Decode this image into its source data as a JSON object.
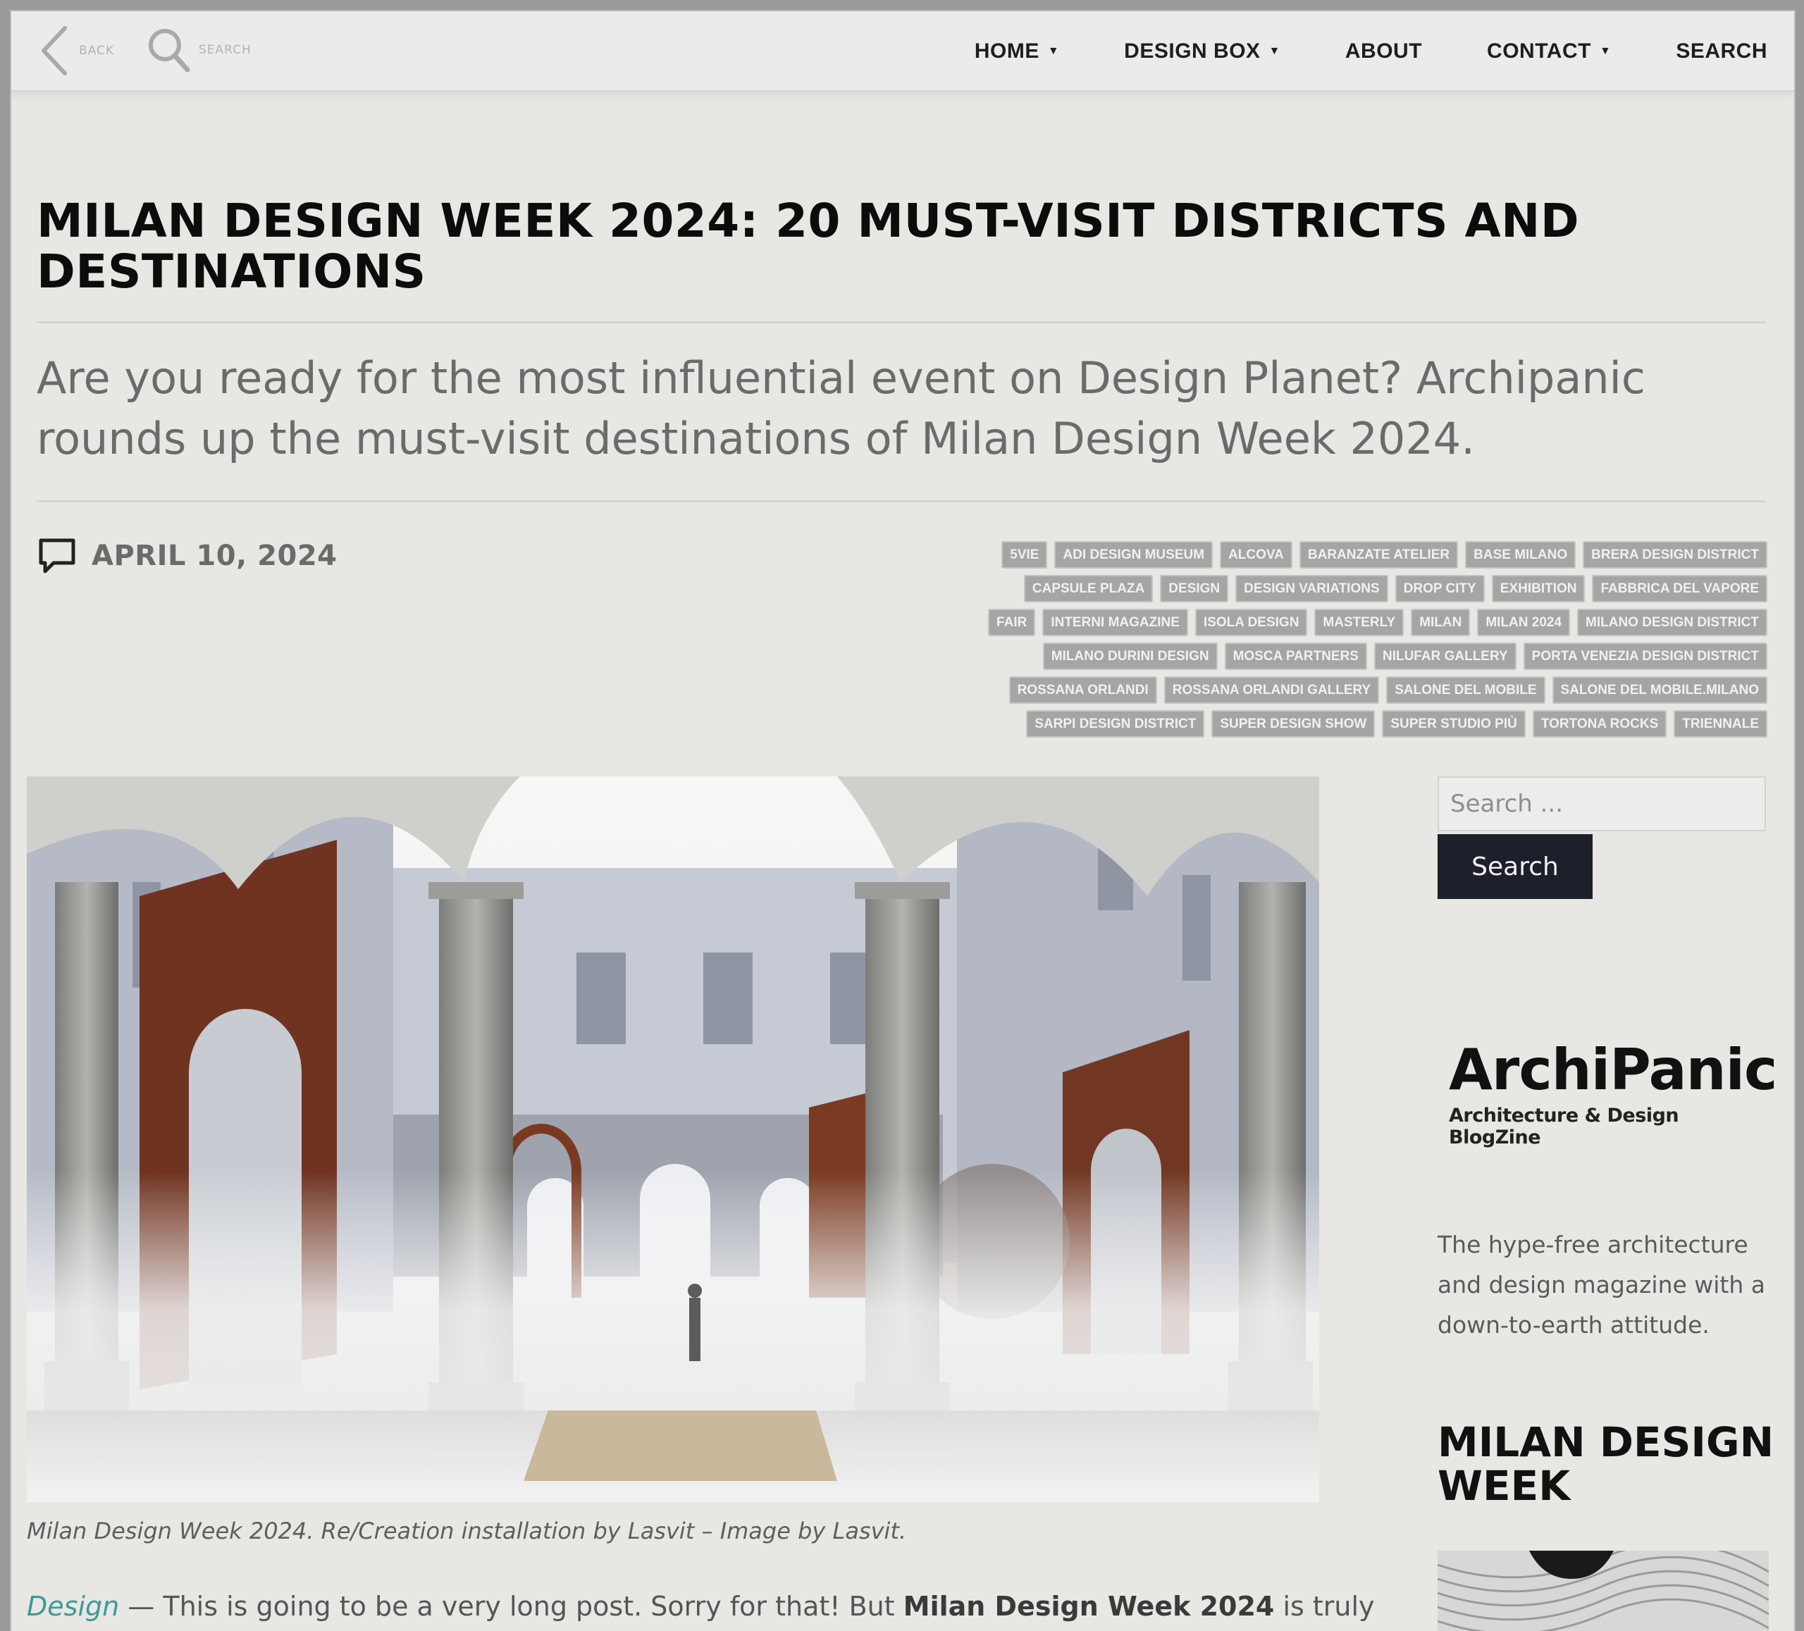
{
  "topbar": {
    "back_label": "BACK",
    "search_label": "SEARCH",
    "nav": [
      {
        "label": "HOME",
        "has_dropdown": true
      },
      {
        "label": "DESIGN BOX",
        "has_dropdown": true
      },
      {
        "label": "ABOUT",
        "has_dropdown": false
      },
      {
        "label": "CONTACT",
        "has_dropdown": true
      },
      {
        "label": "SEARCH",
        "has_dropdown": false
      }
    ]
  },
  "article": {
    "title": "MILAN DESIGN WEEK 2024: 20 MUST-VISIT DISTRICTS AND DESTINATIONS",
    "subtitle": "Are you ready for the most influential event on Design Planet? Archipanic rounds up the must-visit destinations of Milan Design Week 2024.",
    "date": "APRIL 10, 2024",
    "tag_rows": [
      [
        "5VIE",
        "ADI DESIGN MUSEUM",
        "ALCOVA",
        "BARANZATE ATELIER",
        "BASE MILANO",
        "BRERA DESIGN DISTRICT"
      ],
      [
        "CAPSULE PLAZA",
        "DESIGN",
        "DESIGN VARIATIONS",
        "DROP CITY",
        "EXHIBITION",
        "FABBRICA DEL VAPORE"
      ],
      [
        "FAIR",
        "INTERNI MAGAZINE",
        "ISOLA DESIGN",
        "MASTERLY",
        "MILAN",
        "MILAN 2024",
        "MILANO DESIGN DISTRICT"
      ],
      [
        "MILANO DURINI DESIGN",
        "MOSCA PARTNERS",
        "NILUFAR GALLERY",
        "PORTA VENEZIA DESIGN DISTRICT"
      ],
      [
        "ROSSANA ORLANDI",
        "ROSSANA ORLANDI GALLERY",
        "SALONE DEL MOBILE",
        "SALONE DEL MOBILE.MILANO"
      ],
      [
        "SARPI DESIGN DISTRICT",
        "SUPER DESIGN SHOW",
        "SUPER STUDIO PIÙ",
        "TORTONA ROCKS",
        "TRIENNALE"
      ]
    ],
    "caption": "Milan Design Week 2024. Re/Creation installation by Lasvit – Image by Lasvit.",
    "body_link": "Design",
    "body_text": " — This is going to be a very long post. Sorry for that! But ",
    "body_bold": "Milan Design Week 2024",
    "body_text2": " is truly"
  },
  "sidebar": {
    "search_placeholder": "Search ...",
    "search_button": "Search",
    "brand_name": "ArchiPanic",
    "brand_tagline": "Architecture & Design BlogZine",
    "about": "The hype-free architecture and design magazine with a down-to-earth attitude.",
    "section_heading": "MILAN DESIGN WEEK"
  },
  "colors": {
    "page_bg": "#e8e7e3",
    "tag_bg": "#a5a5a5",
    "link": "#3a9a97",
    "button_bg": "#1d1f2b",
    "corten": "#7a3a22"
  }
}
